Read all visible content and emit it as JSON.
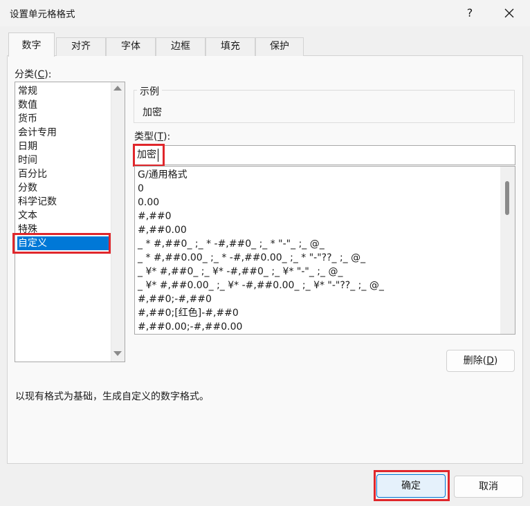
{
  "window": {
    "title": "设置单元格格式",
    "help_label": "?"
  },
  "tabs": [
    {
      "label": "数字",
      "active": true
    },
    {
      "label": "对齐",
      "active": false
    },
    {
      "label": "字体",
      "active": false
    },
    {
      "label": "边框",
      "active": false
    },
    {
      "label": "填充",
      "active": false
    },
    {
      "label": "保护",
      "active": false
    }
  ],
  "category": {
    "label_text": "分类(",
    "label_key": "C",
    "label_end": "):",
    "items": [
      "常规",
      "数值",
      "货币",
      "会计专用",
      "日期",
      "时间",
      "百分比",
      "分数",
      "科学记数",
      "文本",
      "特殊",
      "自定义"
    ],
    "selected": "自定义"
  },
  "sample": {
    "title": "示例",
    "value": "加密"
  },
  "type_field": {
    "label_text": "类型(",
    "label_key": "T",
    "label_end": "):",
    "value": "加密"
  },
  "format_list": [
    "G/通用格式",
    "0",
    "0.00",
    "#,##0",
    "#,##0.00",
    "_ * #,##0_ ;_ * -#,##0_ ;_ * \"-\"_ ;_ @_",
    "_ * #,##0.00_ ;_ * -#,##0.00_ ;_ * \"-\"??_ ;_ @_",
    "_ ¥* #,##0_ ;_ ¥* -#,##0_ ;_ ¥* \"-\"_ ;_ @_",
    "_ ¥* #,##0.00_ ;_ ¥* -#,##0.00_ ;_ ¥* \"-\"??_ ;_ @_",
    "#,##0;-#,##0",
    "#,##0;[红色]-#,##0",
    "#,##0.00;-#,##0.00"
  ],
  "delete_button": {
    "label_text": "删除(",
    "label_key": "D",
    "label_end": ")"
  },
  "description": "以现有格式为基础，生成自定义的数字格式。",
  "footer": {
    "ok_label": "确定",
    "cancel_label": "取消"
  },
  "colors": {
    "accent": "#0078d7",
    "highlight_outline": "#e0262b"
  }
}
